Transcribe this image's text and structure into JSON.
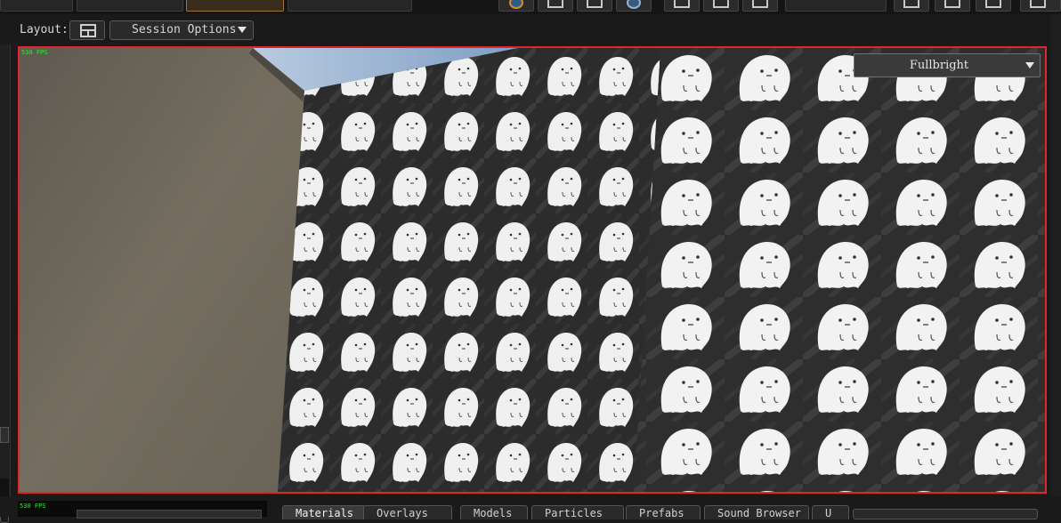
{
  "layoutbar": {
    "layout_label": "Layout:",
    "session_options_label": "Session Options"
  },
  "viewport": {
    "fps_text": "530 FPS",
    "render_mode_label": "Fullbright"
  },
  "bottom": {
    "fps_text": "530 FPS",
    "tabs": [
      "Materials",
      "Overlays",
      "Models",
      "Particles",
      "Prefabs",
      "Sound Browser",
      "U"
    ]
  },
  "scene": {
    "sky_color": "#8ea9c9",
    "concrete_color": "#6b655a",
    "tile_color": "#2c2c2c",
    "ghost_color": "#f2f2f2"
  },
  "icons": [
    "layout-grid-icon",
    "dropdown-triangle-icon",
    "globe-icon",
    "move-icon",
    "select-icon",
    "hammer-icon"
  ]
}
